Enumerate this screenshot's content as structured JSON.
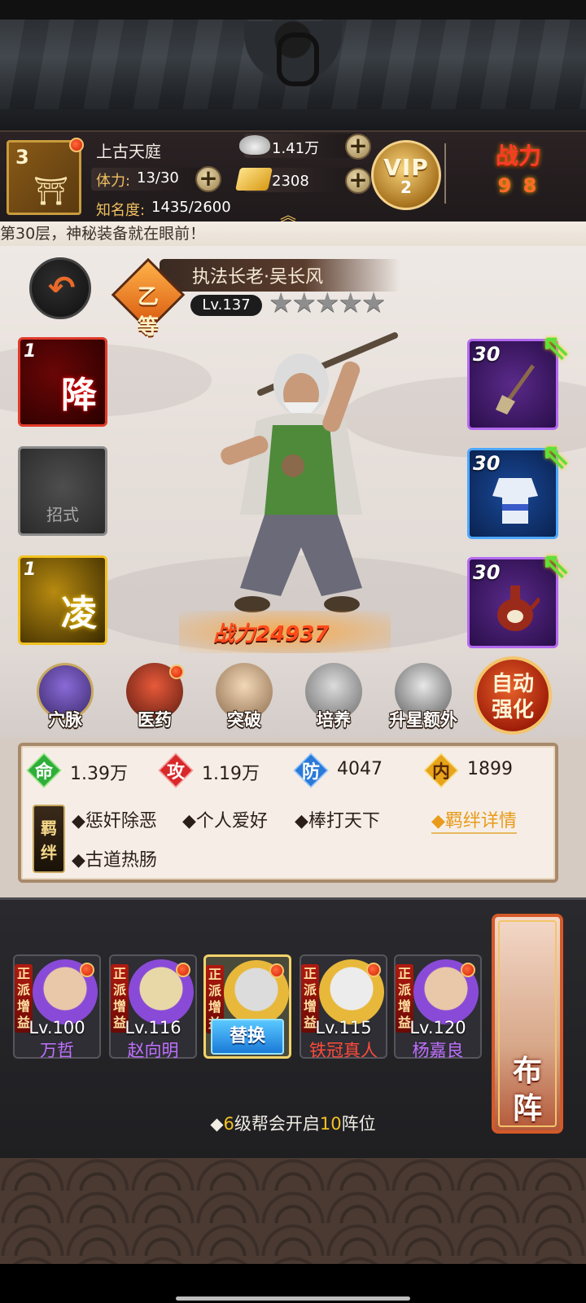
{
  "header": {
    "player_level": "3",
    "player_name": "上古天庭",
    "stamina_label": "体力:",
    "stamina_value": "13/30",
    "fame_label": "知名度:",
    "fame_value": "1435/2600",
    "silver": "1.41万",
    "gold": "2308",
    "vip_label": "VIP",
    "vip_level": "2",
    "power_label": "战力",
    "power_value": "9  8"
  },
  "marquee": "第30层，神秘装备就在眼前！",
  "hero": {
    "name": "执法长老·吴长风",
    "grade": "乙等",
    "level": "Lv.137",
    "stars": "★★★★★",
    "power": "战力24937"
  },
  "skills": [
    {
      "level": "1",
      "char": "降"
    },
    {
      "empty_label": "招式"
    },
    {
      "level": "1",
      "char": "凌"
    }
  ],
  "equipment": [
    {
      "level": "30",
      "icon": "shovel-icon"
    },
    {
      "level": "30",
      "icon": "robe-icon"
    },
    {
      "level": "30",
      "icon": "teapot-icon"
    }
  ],
  "functions": [
    "穴脉",
    "医药",
    "突破",
    "培养",
    "升星额外"
  ],
  "auto_button": [
    "自动",
    "强化"
  ],
  "stats": {
    "hp": {
      "icon": "命",
      "value": "1.39万",
      "color": "#2fae3a"
    },
    "atk": {
      "icon": "攻",
      "value": "1.19万",
      "color": "#d8282a"
    },
    "def": {
      "icon": "防",
      "value": "4047",
      "color": "#2a7ad8"
    },
    "inner": {
      "icon": "内",
      "value": "1899",
      "color": "#e8a41a"
    }
  },
  "bonds": {
    "tag": [
      "羁",
      "绊"
    ],
    "items": [
      "◆惩奸除恶",
      "◆个人爱好",
      "◆棒打天下",
      "◆古道热肠"
    ],
    "detail": "◆羁绊详情"
  },
  "team": [
    {
      "sect": "正派增益",
      "level": "Lv.100",
      "name": "万哲",
      "name_color": "#c070ff"
    },
    {
      "sect": "正派增益",
      "level": "Lv.116",
      "name": "赵向明",
      "name_color": "#c070ff"
    },
    {
      "sect": "正派增益",
      "swap_label": "替换"
    },
    {
      "sect": "正派增益",
      "level": "Lv.115",
      "name": "铁冠真人",
      "name_color": "#ff4a3a"
    },
    {
      "sect": "正派增益",
      "level": "Lv.120",
      "name": "杨嘉良",
      "name_color": "#c070ff"
    }
  ],
  "formation": [
    "布",
    "阵"
  ],
  "notice": {
    "prefix": "◆",
    "num1": "6",
    "mid": "级帮会开启",
    "num2": "10",
    "suffix": "阵位"
  }
}
